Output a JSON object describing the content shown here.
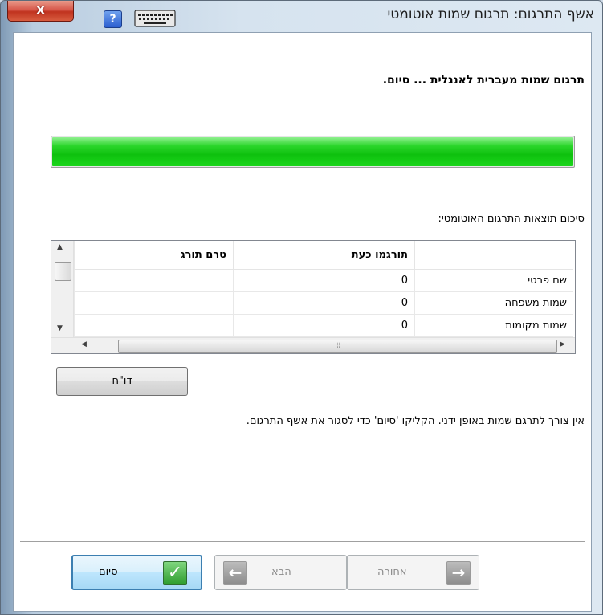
{
  "window": {
    "title": "אשף התרגום: תרגום שמות אוטומטי",
    "close_label": "x",
    "help_label": "?"
  },
  "main": {
    "headline": "תרגום שמות מעברית לאנגלית ... סיום.",
    "progress_fraction": 1.0,
    "summary_label": "סיכום תוצאות התרגום האוטומטי:",
    "table": {
      "columns": [
        "טרם תורג",
        "תורגמו כעת",
        ""
      ],
      "rows": [
        [
          "",
          "0",
          "שם פרטי"
        ],
        [
          "",
          "0",
          "שמות משפחה"
        ],
        [
          "",
          "0",
          "שמות מקומות"
        ]
      ]
    },
    "report_button": "דו\"ח",
    "info_text": "אין צורך לתרגם שמות באופן ידני. הקליקו 'סיום' כדי לסגור את אשף התרגום."
  },
  "footer": {
    "finish_label": "סיום",
    "next_label": "הבא",
    "back_label": "אחורה"
  },
  "icons": {
    "close": "close-icon",
    "help": "help-icon",
    "keyboard": "keyboard-icon",
    "finish": "checkmark-icon",
    "next": "arrow-left-icon",
    "back": "arrow-right-icon"
  },
  "colors": {
    "progress": "#0ec10e",
    "finish_border": "#3c7fb1",
    "close": "#c0331f"
  }
}
